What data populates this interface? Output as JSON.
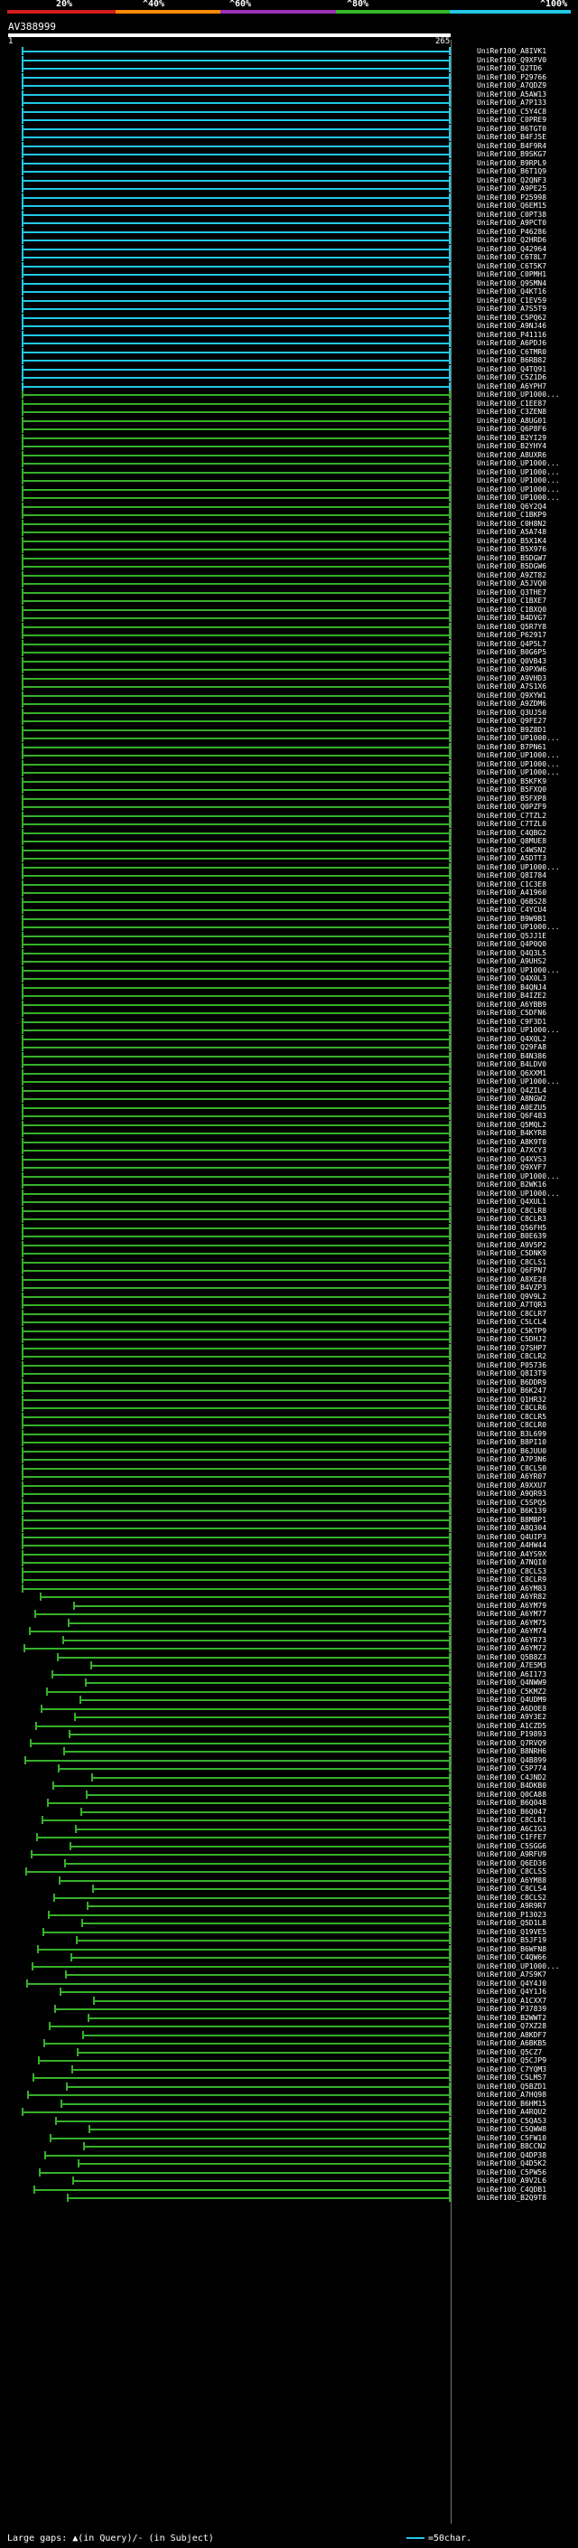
{
  "scale": {
    "labels": [
      "20%",
      "^40%",
      "^60%",
      "^80%",
      "^100%"
    ],
    "colors": [
      "#d41c1c",
      "#ff8a00",
      "#9b31b5",
      "#35b82a",
      "#22c8e6"
    ]
  },
  "query": {
    "id": "AV388999",
    "start": "1",
    "end": "265"
  },
  "colors": {
    "cyan": "#22c8e6",
    "green": "#36b02a"
  },
  "hits": [
    "UniRef100_A8IVK1",
    "UniRef100_Q9XFV0",
    "UniRef100_Q2TD6",
    "UniRef100_P29766",
    "UniRef100_A7QDZ9",
    "UniRef100_A5AW13",
    "UniRef100_A7P133",
    "UniRef100_C5Y4C8",
    "UniRef100_C0PRE9",
    "UniRef100_B6TGT0",
    "UniRef100_B4FJ5E",
    "UniRef100_B4F9R4",
    "UniRef100_B9SKG7",
    "UniRef100_B9RPL9",
    "UniRef100_B6T1Q9",
    "UniRef100_Q2QNF3",
    "UniRef100_A9PE25",
    "UniRef100_P25998",
    "UniRef100_Q6EM15",
    "UniRef100_C0PT38",
    "UniRef100_A9PCT0",
    "UniRef100_P46286",
    "UniRef100_Q2HRD6",
    "UniRef100_Q42964",
    "UniRef100_C6T8L7",
    "UniRef100_C6T5K7",
    "UniRef100_C0PMH1",
    "UniRef100_Q9SMN4",
    "UniRef100_Q4KT16",
    "UniRef100_C1EV59",
    "UniRef100_A7S5T9",
    "UniRef100_C5PQ62",
    "UniRef100_A9NJ46",
    "UniRef100_P41116",
    "UniRef100_A6PDJ6",
    "UniRef100_C6TMR0",
    "UniRef100_B6RB82",
    "UniRef100_Q4TQ91",
    "UniRef100_C5Z1D6",
    "UniRef100_A6YPH7",
    "UniRef100_UP1000...",
    "UniRef100_C1EE87",
    "UniRef100_C3ZEN8",
    "UniRef100_A8UG01",
    "UniRef100_Q6P8F6",
    "UniRef100_B2YI29",
    "UniRef100_B2YHY4",
    "UniRef100_A8UXR6",
    "UniRef100_UP1000...",
    "UniRef100_UP1000...",
    "UniRef100_UP1000...",
    "UniRef100_UP1000...",
    "UniRef100_UP1000...",
    "UniRef100_Q6Y2Q4",
    "UniRef100_C1BKP9",
    "UniRef100_C0H8N2",
    "UniRef100_A5A748",
    "UniRef100_B5X1K4",
    "UniRef100_B5X976",
    "UniRef100_B5DGW7",
    "UniRef100_B5DGW6",
    "UniRef100_A9ZT82",
    "UniRef100_A5JVQ0",
    "UniRef100_Q3THE7",
    "UniRef100_C1BXE7",
    "UniRef100_C1BXQ0",
    "UniRef100_B4DVG7",
    "UniRef100_Q5R7Y8",
    "UniRef100_P62917",
    "UniRef100_Q4P5L7",
    "UniRef100_B0G6P5",
    "UniRef100_Q0VB43",
    "UniRef100_A9PXW6",
    "UniRef100_A9VHD3",
    "UniRef100_A7S1X6",
    "UniRef100_Q9XYW1",
    "UniRef100_A9ZDM6",
    "UniRef100_Q3UJ50",
    "UniRef100_Q9FE27",
    "UniRef100_B9Z8D1",
    "UniRef100_UP1000...",
    "UniRef100_B7PN61",
    "UniRef100_UP1000...",
    "UniRef100_UP1000...",
    "UniRef100_UP1000...",
    "UniRef100_B5KFK9",
    "UniRef100_B5FXQ0",
    "UniRef100_B5FXP8",
    "UniRef100_Q0PZF9",
    "UniRef100_C7TZL2",
    "UniRef100_C7TZL0",
    "UniRef100_C4QBG2",
    "UniRef100_Q8MUE8",
    "UniRef100_C4WSN2",
    "UniRef100_A5DTT3",
    "UniRef100_UP1000...",
    "UniRef100_Q8I784",
    "UniRef100_C1C3E8",
    "UniRef100_A41960",
    "UniRef100_Q6BS28",
    "UniRef100_C4YCU4",
    "UniRef100_B9W9B1",
    "UniRef100_UP1000...",
    "UniRef100_Q5JJ1E",
    "UniRef100_Q4P0Q0",
    "UniRef100_Q4Q3L5",
    "UniRef100_A9UHS2",
    "UniRef100_UP1000...",
    "UniRef100_Q4X0L3",
    "UniRef100_B4QNJ4",
    "UniRef100_B4IZE2",
    "UniRef100_A6YBB9",
    "UniRef100_C5DFN6",
    "UniRef100_C9F3D1",
    "UniRef100_UP1000...",
    "UniRef100_Q4XQL2",
    "UniRef100_Q29FA8",
    "UniRef100_B4N386",
    "UniRef100_B4LDV0",
    "UniRef100_Q6XXM1",
    "UniRef100_UP1000...",
    "UniRef100_Q4ZIL4",
    "UniRef100_A8NGW2",
    "UniRef100_A0EZU5",
    "UniRef100_Q6F483",
    "UniRef100_Q5MQL2",
    "UniRef100_B4KYR8",
    "UniRef100_A8K9T0",
    "UniRef100_A7XCY3",
    "UniRef100_Q4XVS3",
    "UniRef100_Q9XVF7",
    "UniRef100_UP1000...",
    "UniRef100_B2WK16",
    "UniRef100_UP1000...",
    "UniRef100_Q4XUL1",
    "UniRef100_C8CLR8",
    "UniRef100_C8CLR3",
    "UniRef100_Q56FH5",
    "UniRef100_B0E639",
    "UniRef100_A9V5P2",
    "UniRef100_C5DNK9",
    "UniRef100_C8CLS1",
    "UniRef100_Q6FPN7",
    "UniRef100_A8XE28",
    "UniRef100_B4VZP3",
    "UniRef100_Q9V9L2",
    "UniRef100_A7TQR3",
    "UniRef100_C8CLR7",
    "UniRef100_C5LCL4",
    "UniRef100_C5KTP9",
    "UniRef100_C5DHJ2",
    "UniRef100_Q7SHP7",
    "UniRef100_C8CLR2",
    "UniRef100_P05736",
    "UniRef100_Q8I3T9",
    "UniRef100_B6DDR9",
    "UniRef100_B6K247",
    "UniRef100_Q1HR32",
    "UniRef100_C8CLR6",
    "UniRef100_C8CLR5",
    "UniRef100_C8CLR0",
    "UniRef100_B3L699",
    "UniRef100_B8PI10",
    "UniRef100_B6JUU0",
    "UniRef100_A7P3N6",
    "UniRef100_C8CLS0",
    "UniRef100_A6YR07",
    "UniRef100_A9XXU7",
    "UniRef100_A9QR93",
    "UniRef100_C5SPQ5",
    "UniRef100_B6K139",
    "UniRef100_B8MBP1",
    "UniRef100_A8Q304",
    "UniRef100_Q4UIP3",
    "UniRef100_A4HW44",
    "UniRef100_A4YS9X",
    "UniRef100_A7NQI0",
    "UniRef100_C8CLS3",
    "UniRef100_C8CLR9",
    "UniRef100_A6YM83",
    "UniRef100_A6YR82",
    "UniRef100_A6YM79",
    "UniRef100_A6YM77",
    "UniRef100_A6YM75",
    "UniRef100_A6YM74",
    "UniRef100_A6YR73",
    "UniRef100_A6YM72",
    "UniRef100_Q5B8Z3",
    "UniRef100_A7E5M3",
    "UniRef100_A6I173",
    "UniRef100_Q4NWW9",
    "UniRef100_C5KMZ2",
    "UniRef100_Q4UDM9",
    "UniRef100_A6DOE8",
    "UniRef100_A9Y3E2",
    "UniRef100_A1CZD5",
    "UniRef100_P19893",
    "UniRef100_Q7RVQ9",
    "UniRef100_B8NRH6",
    "UniRef100_Q4B899",
    "UniRef100_C5P774",
    "UniRef100_C4JND2",
    "UniRef100_B4DKB0",
    "UniRef100_Q0CA88",
    "UniRef100_B6Q048",
    "UniRef100_B6Q047",
    "UniRef100_C8CLR1",
    "UniRef100_A6CIG3",
    "UniRef100_C1FFE7",
    "UniRef100_C5SGG6",
    "UniRef100_A9RFU9",
    "UniRef100_Q6ED36",
    "UniRef100_C8CLS5",
    "UniRef100_A6YM88",
    "UniRef100_C8CLS4",
    "UniRef100_C8CLS2",
    "UniRef100_A9R9R7",
    "UniRef100_P13023",
    "UniRef100_Q5D1L8",
    "UniRef100_Q19VE5",
    "UniRef100_B5JF19",
    "UniRef100_B6WFN8",
    "UniRef100_C4QW66",
    "UniRef100_UP1000...",
    "UniRef100_A7S9K7",
    "UniRef100_Q4Y4J0",
    "UniRef100_Q4Y1J6",
    "UniRef100_A1CXX7",
    "UniRef100_P37839",
    "UniRef100_B2WWT2",
    "UniRef100_Q7XZ28",
    "UniRef100_A8KDF7",
    "UniRef100_A6BKB5",
    "UniRef100_Q5CZ7",
    "UniRef100_Q5CJP9",
    "UniRef100_C7YQM3",
    "UniRef100_C5LM57",
    "UniRef100_Q5BZD1",
    "UniRef100_A7HQ98",
    "UniRef100_B6HM15",
    "UniRef100_A4RQU2",
    "UniRef100_C5QA53",
    "UniRef100_C5QWW8",
    "UniRef100_C5FW10",
    "UniRef100_B8CCN2",
    "UniRef100_Q4DP38",
    "UniRef100_Q4D5K2",
    "UniRef100_C5PW56",
    "UniRef100_A9V2L6",
    "UniRef100_C4QDB1",
    "UniRef100_B2Q9T8"
  ],
  "legend": {
    "gaps": "Large gaps: ▲(in Query)/- (in Subject)",
    "scale": "=50char."
  }
}
